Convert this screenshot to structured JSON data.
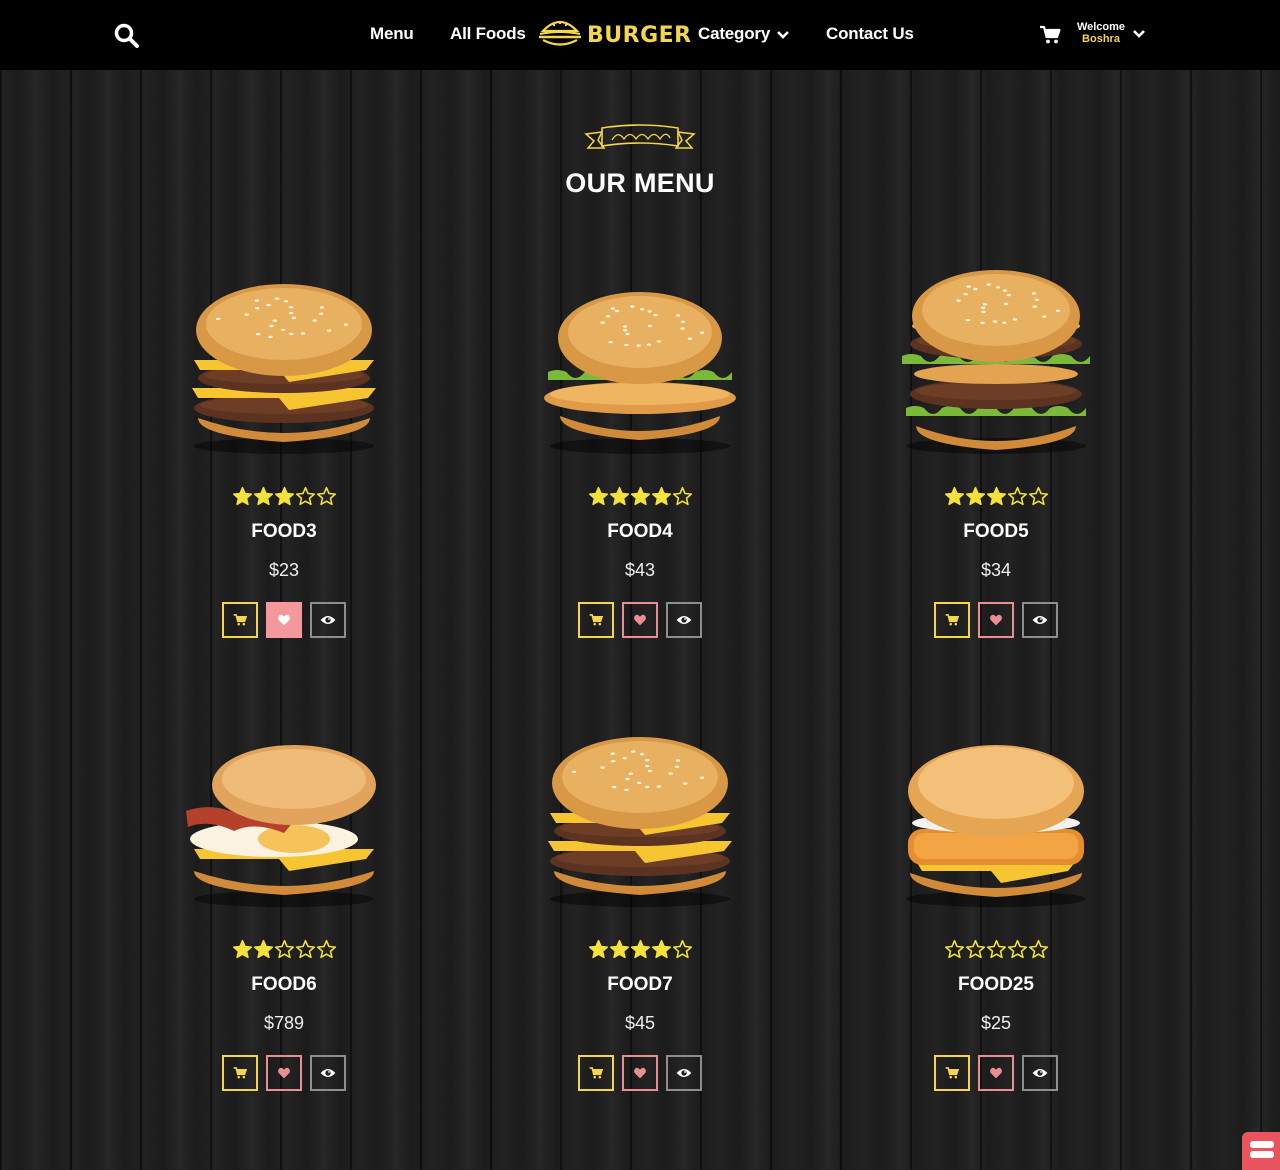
{
  "nav": {
    "menu": "Menu",
    "all_foods": "All Foods",
    "logo_text": "BURGER",
    "category": "Category",
    "contact": "Contact Us",
    "welcome": "Welcome",
    "user": "Boshra"
  },
  "section_title": "OUR MENU",
  "colors": {
    "accent": "#f4d64a",
    "heart": "#e98f93",
    "view": "#8e8e8e"
  },
  "items": [
    {
      "name": "FOOD3",
      "price": "$23",
      "rating": 3,
      "favorited": true,
      "style": "double-cheese"
    },
    {
      "name": "FOOD4",
      "price": "$43",
      "rating": 4,
      "favorited": false,
      "style": "chicken"
    },
    {
      "name": "FOOD5",
      "price": "$34",
      "rating": 3,
      "favorited": false,
      "style": "big-mac"
    },
    {
      "name": "FOOD6",
      "price": "$789",
      "rating": 2,
      "favorited": false,
      "style": "muffin"
    },
    {
      "name": "FOOD7",
      "price": "$45",
      "rating": 4,
      "favorited": false,
      "style": "double-cheese"
    },
    {
      "name": "FOOD25",
      "price": "$25",
      "rating": 0,
      "favorited": false,
      "style": "fish"
    }
  ]
}
